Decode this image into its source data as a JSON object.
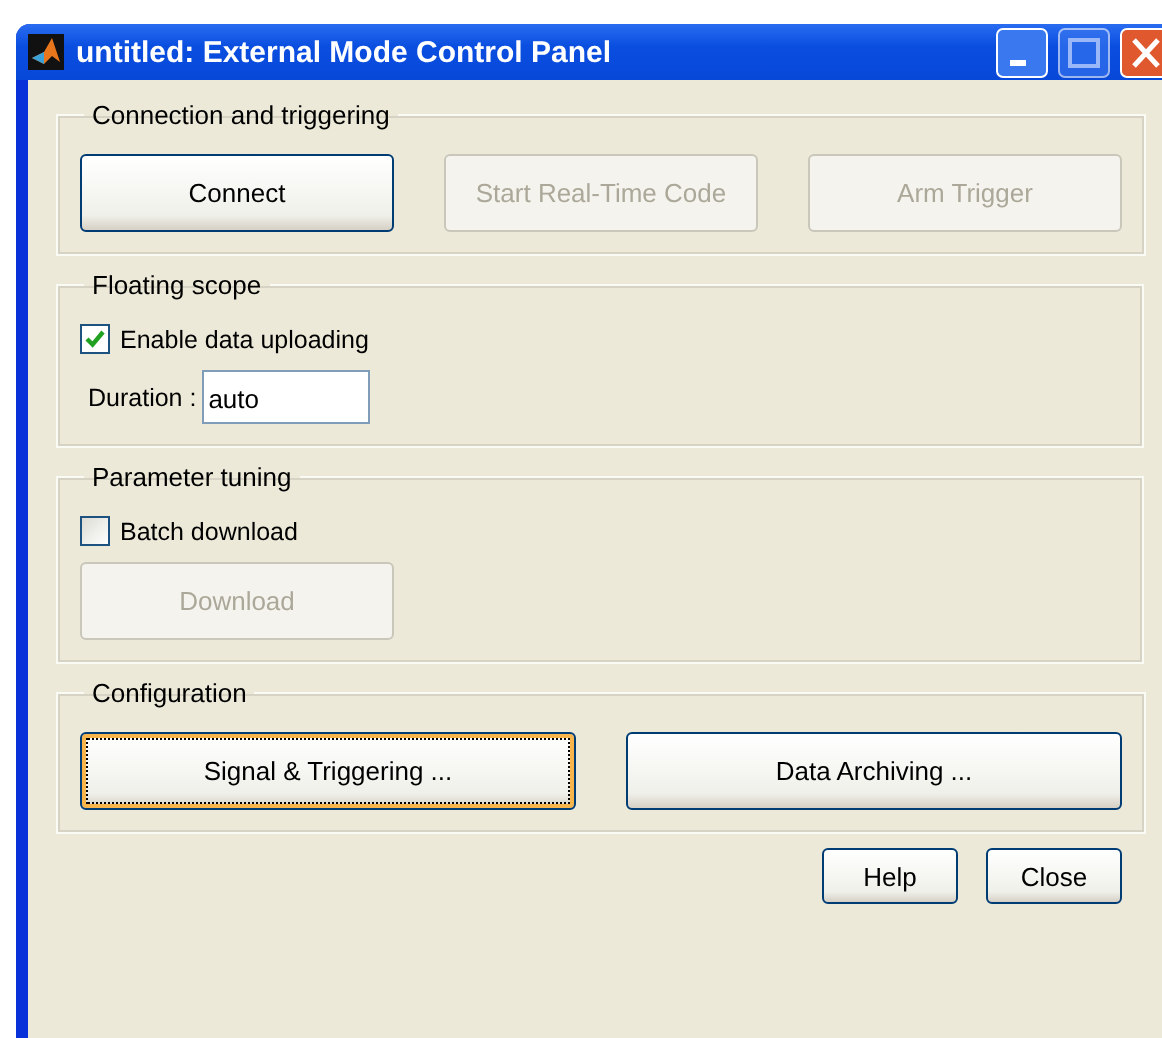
{
  "window": {
    "title": "untitled: External Mode Control Panel"
  },
  "sections": [
    {
      "title": "Connection and triggering",
      "rows": [
        [
          {
            "kind": "button",
            "label": "Connect",
            "disabled": false,
            "focused": false
          },
          {
            "kind": "button",
            "label": "Start Real-Time Code",
            "disabled": true,
            "focused": false
          },
          {
            "kind": "button",
            "label": "Arm Trigger",
            "disabled": true,
            "focused": false
          }
        ]
      ]
    },
    {
      "title": "Floating scope",
      "rows": [
        [
          {
            "kind": "checkbox",
            "label": "Enable data uploading",
            "checked": true
          }
        ],
        [
          {
            "kind": "field",
            "label": "Duration :",
            "value": "auto"
          }
        ]
      ]
    },
    {
      "title": "Parameter tuning",
      "rows": [
        [
          {
            "kind": "checkbox",
            "label": "Batch download",
            "checked": false
          }
        ],
        [
          {
            "kind": "button",
            "label": "Download",
            "disabled": true,
            "focused": false
          }
        ]
      ]
    },
    {
      "title": "Configuration",
      "rows": [
        [
          {
            "kind": "button",
            "label": "Signal & Triggering ...",
            "disabled": false,
            "focused": true
          },
          {
            "kind": "button",
            "label": "Data Archiving ...",
            "disabled": false,
            "focused": false
          }
        ]
      ]
    }
  ],
  "footer_buttons": [
    {
      "label": "Help"
    },
    {
      "label": "Close"
    }
  ]
}
